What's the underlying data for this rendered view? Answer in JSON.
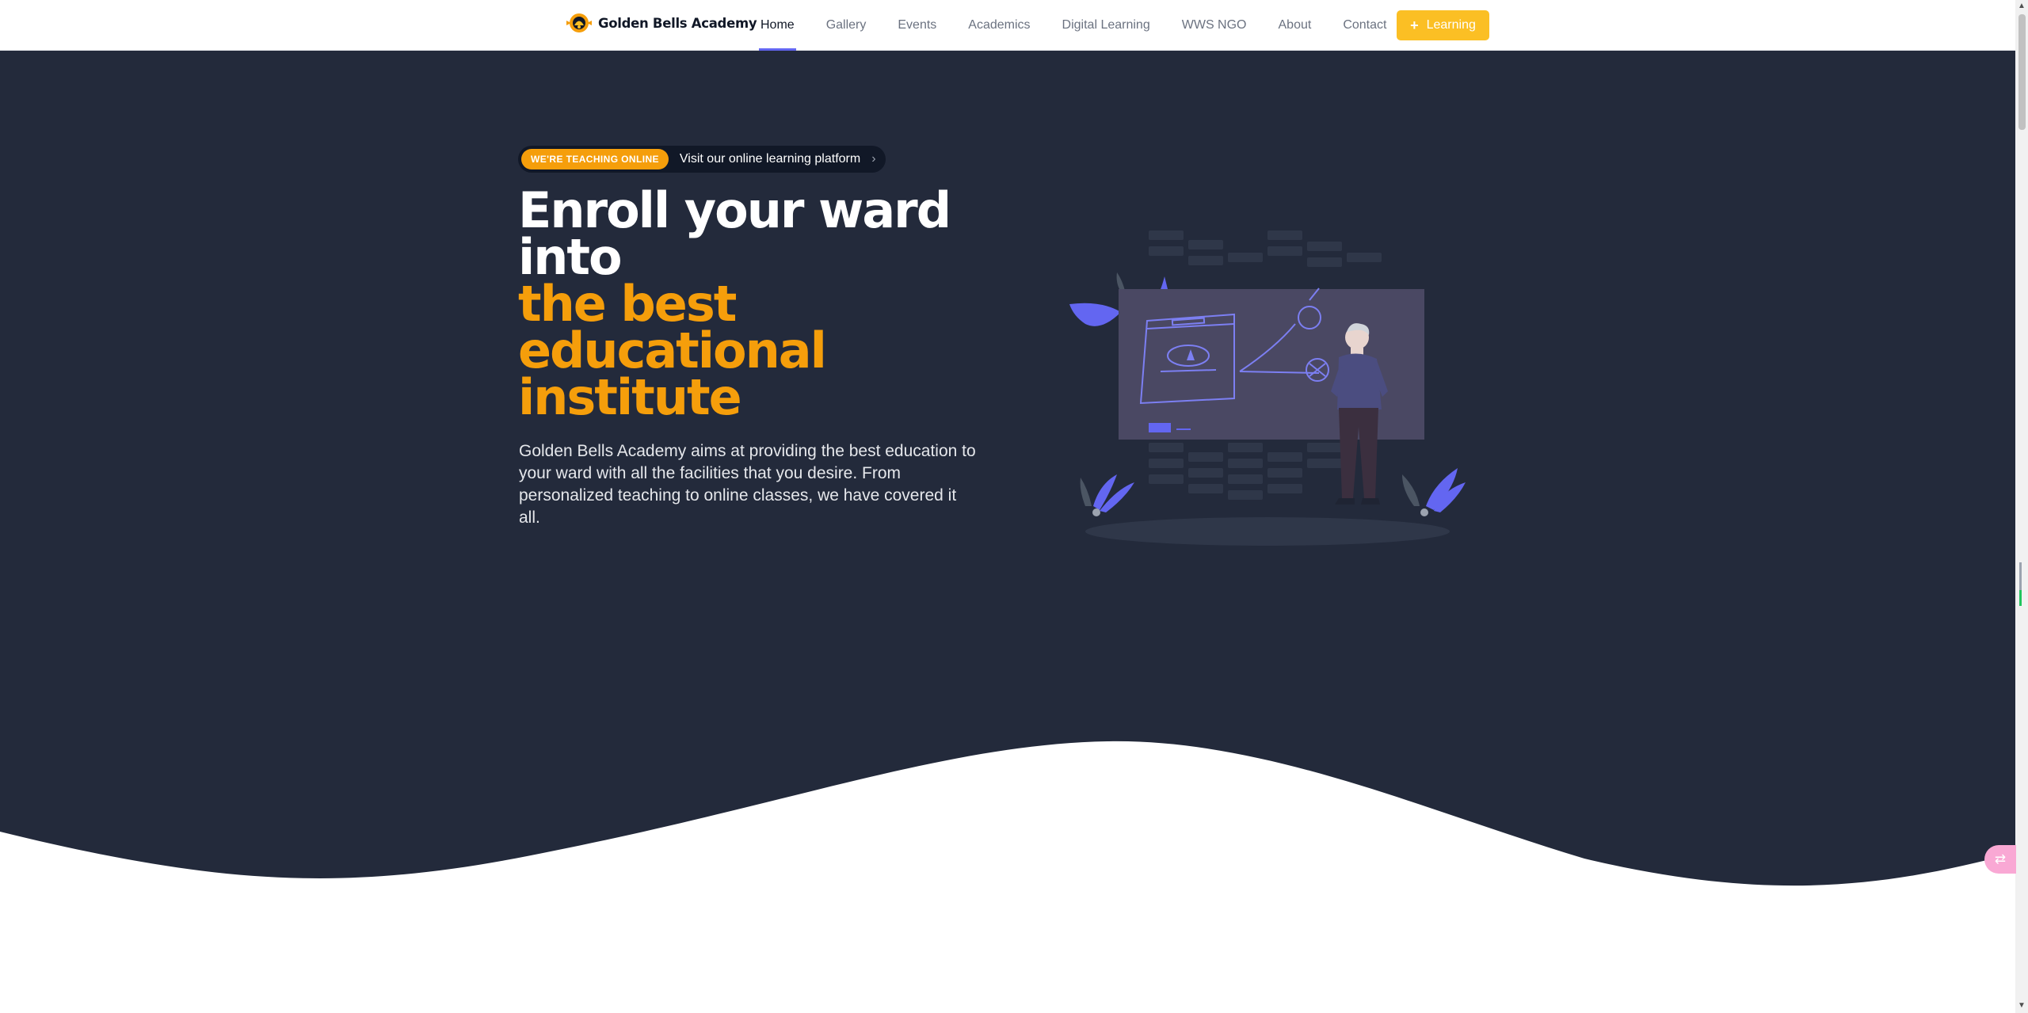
{
  "brand": {
    "name": "Golden Bells Academy",
    "logo_icon": "bell-logo-icon"
  },
  "nav": {
    "items": [
      {
        "label": "Home",
        "active": true
      },
      {
        "label": "Gallery"
      },
      {
        "label": "Events"
      },
      {
        "label": "Academics"
      },
      {
        "label": "Digital Learning"
      },
      {
        "label": "WWS NGO"
      },
      {
        "label": "About"
      },
      {
        "label": "Contact"
      }
    ],
    "cta": {
      "icon": "+",
      "label": "Learning"
    }
  },
  "hero": {
    "badge": "WE'RE TEACHING ONLINE",
    "badge_link": "Visit our online learning platform",
    "badge_chevron": "›",
    "headline_line1": "Enroll your ward",
    "headline_line2": "into",
    "headline_accent1": "the best",
    "headline_accent2": "educational",
    "headline_accent3": "institute",
    "description": "Golden Bells Academy aims at providing the best education to your ward with all the facilities that you desire. From personalized teaching to online classes, we have covered it all."
  },
  "colors": {
    "nav_bg": "#ffffff",
    "hero_bg": "#232a3b",
    "accent": "#f59e0b",
    "cta": "#fbbf24",
    "indigo": "#6366f1"
  },
  "widgets": {
    "translate_icon": "translate-icon"
  }
}
